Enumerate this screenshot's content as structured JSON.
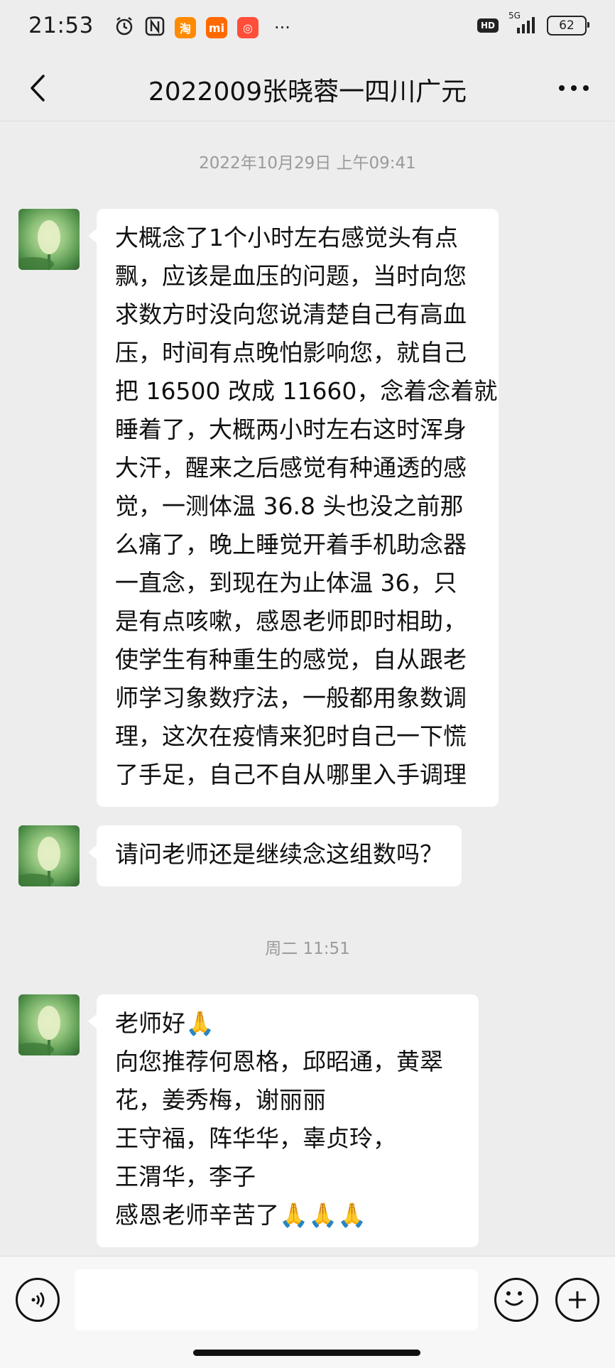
{
  "status_bar": {
    "time": "21:53",
    "battery": "62",
    "network": "5G",
    "hd": "HD",
    "more": "···",
    "app_icons": [
      "alarm-icon",
      "nfc-icon",
      "taobao-icon",
      "mi-icon",
      "kuaishou-icon"
    ]
  },
  "nav": {
    "title": "2022009张晓蓉一四川广元",
    "more": "···"
  },
  "timestamps": [
    "2022年10月29日 上午09:41",
    "周二 11:51"
  ],
  "messages": [
    {
      "lines": [
        "大概念了1个小时左右感觉头有点",
        "飘，应该是血压的问题，当时向您",
        "求数方时没向您说清楚自己有高血",
        "压，时间有点晚怕影响您，就自己",
        "把 16500 改成 11660，念着念着就",
        "睡着了，大概两小时左右这时浑身",
        "大汗，醒来之后感觉有种通透的感",
        "觉，一测体温 36.8 头也没之前那",
        "么痛了，晚上睡觉开着手机助念器",
        "一直念，到现在为止体温 36，只",
        "是有点咳嗽，感恩老师即时相助，",
        "使学生有种重生的感觉，自从跟老",
        "师学习象数疗法，一般都用象数调",
        "理，这次在疫情来犯时自己一下慌",
        "了手足，自己不自从哪里入手调理"
      ]
    },
    {
      "lines": [
        "请问老师还是继续念这组数吗？"
      ]
    },
    {
      "lines": [
        "老师好🙏",
        "向您推荐何恩格，邱昭通，黄翠",
        "花，姜秀梅，谢丽丽",
        "王守福，阵华华，辜贞玲，",
        "王渭华，李子",
        "感恩老师辛苦了🙏🙏🙏"
      ]
    }
  ],
  "input": {
    "value": "",
    "placeholder": ""
  }
}
